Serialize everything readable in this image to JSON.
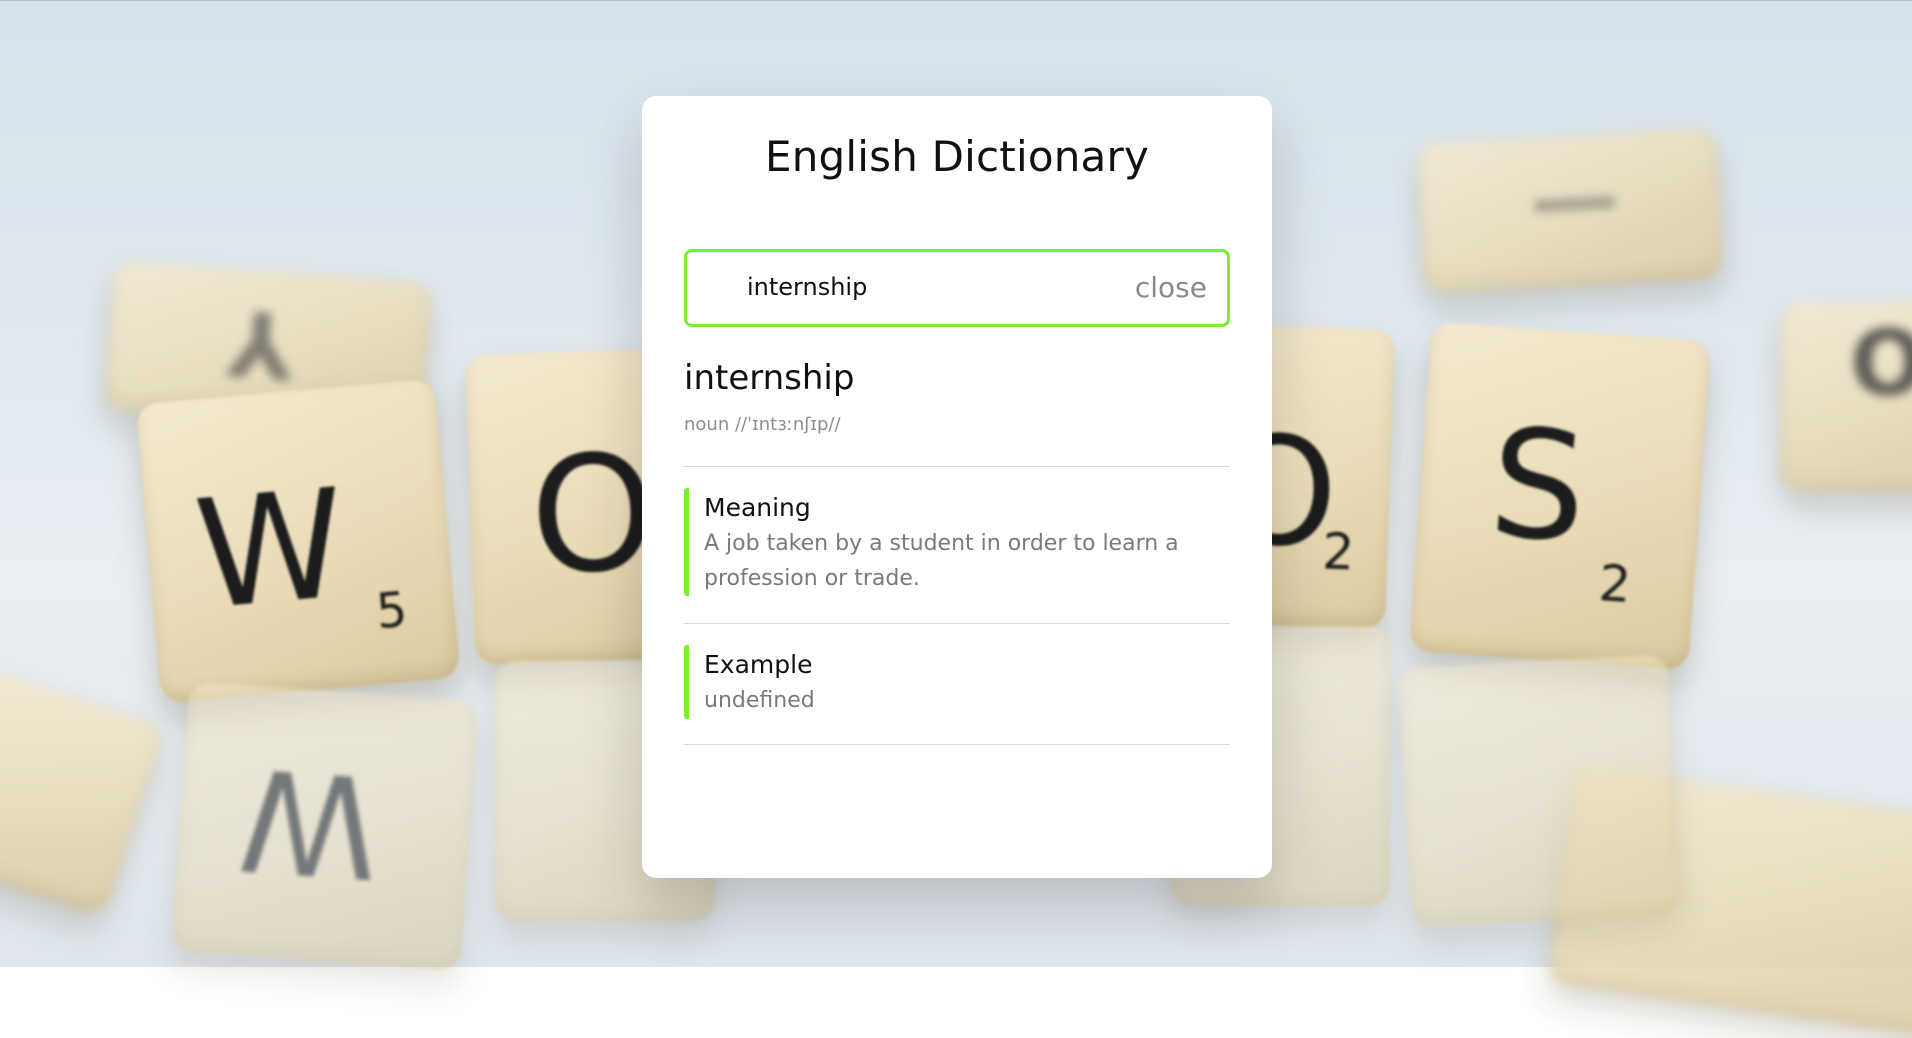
{
  "app": {
    "title": "English Dictionary"
  },
  "search": {
    "value": "internship",
    "placeholder": "",
    "close_label": "close"
  },
  "result": {
    "word": "internship",
    "phonetic": "noun //ˈɪntɜːnʃɪp//",
    "meaning": {
      "heading": "Meaning",
      "text": "A job taken by a student in order to learn a profession or trade."
    },
    "example": {
      "heading": "Example",
      "text": "undefined"
    }
  },
  "background": {
    "tiles": [
      {
        "letter": "W",
        "score": "5"
      },
      {
        "letter": "O",
        "score": ""
      },
      {
        "letter": "O",
        "score": "2"
      },
      {
        "letter": "S",
        "score": "2"
      },
      {
        "letter": "Y",
        "score": ""
      },
      {
        "letter": "O",
        "score": ""
      }
    ]
  },
  "colors": {
    "accent": "#74f22e",
    "card_bg": "#ffffff",
    "muted_text": "#7a7a7a"
  }
}
